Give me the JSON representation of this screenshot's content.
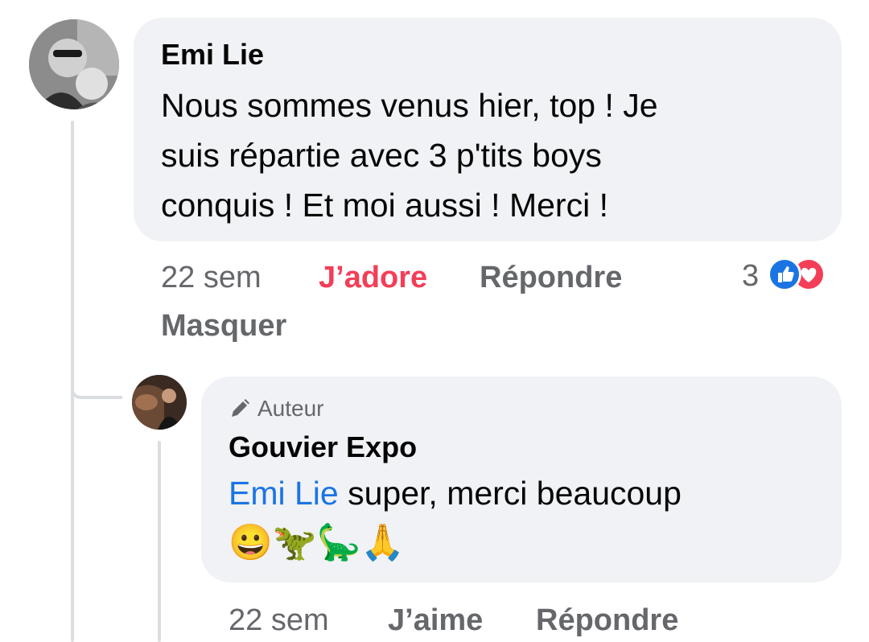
{
  "comment": {
    "author": "Emi Lie",
    "text_lines": [
      "Nous sommes venus hier, top ! Je",
      "suis répartie avec 3 p'tits boys",
      "conquis ! Et moi aussi ! Merci !"
    ],
    "time": "22 sem",
    "react_label": "J’adore",
    "reply_label": "Répondre",
    "hide_label": "Masquer",
    "reaction_count": "3",
    "reaction_icons": [
      "like-icon",
      "love-icon"
    ],
    "colors": {
      "like": "#1b74e4",
      "love": "#f33e58"
    }
  },
  "reply": {
    "badge_label": "Auteur",
    "badge_icon": "pencil-icon",
    "author": "Gouvier Expo",
    "mention": "Emi Lie",
    "text": " super, merci beaucoup",
    "emojis": "😀🦖🦕🙏",
    "time": "22 sem",
    "like_label": "J’aime",
    "reply_label": "Répondre"
  }
}
